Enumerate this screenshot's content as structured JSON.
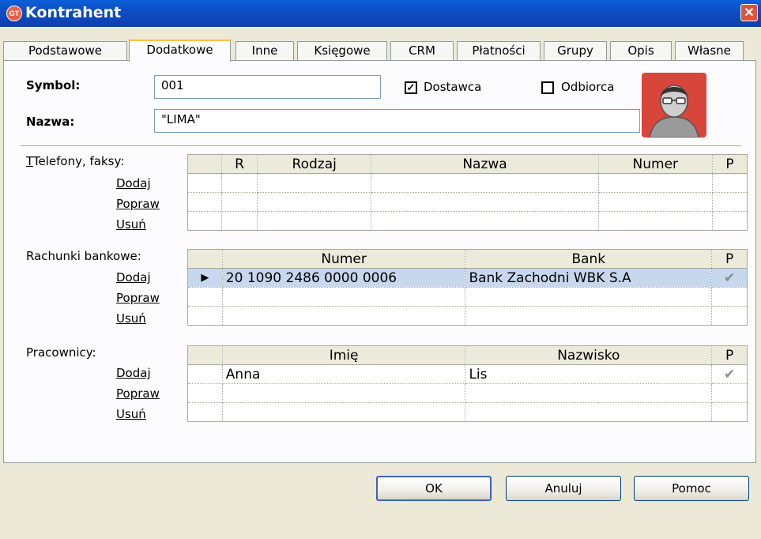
{
  "window": {
    "title": "Kontrahent",
    "close_glyph": "✕",
    "icon_text": "GT"
  },
  "tabs": [
    "Podstawowe",
    "Dodatkowe",
    "Inne",
    "Księgowe",
    "CRM",
    "Płatności",
    "Grupy",
    "Opis",
    "Własne"
  ],
  "active_tab": "Dodatkowe",
  "form": {
    "symbol_label": "Symbol:",
    "symbol_value": "001",
    "nazwa_label": "Nazwa:",
    "nazwa_value": "\"LIMA\"",
    "dostawca_label": "Dostawca",
    "dostawca_checked": true,
    "odbiorca_label": "Odbiorca",
    "odbiorca_checked": false
  },
  "actions": {
    "add": "Dodaj",
    "edit": "Popraw",
    "delete": "Usuń"
  },
  "phones": {
    "label": "Telefony, faksy:",
    "columns": [
      "R",
      "Rodzaj",
      "Nazwa",
      "Numer",
      "P"
    ]
  },
  "accounts": {
    "label": "Rachunki bankowe:",
    "columns": [
      "Numer",
      "Bank",
      "P"
    ],
    "rows": [
      {
        "numer": "20 1090 2486 0000 0006",
        "bank": "Bank Zachodni WBK S.A",
        "p": "✔"
      }
    ]
  },
  "employees": {
    "label": "Pracownicy:",
    "columns": [
      "Imię",
      "Nazwisko",
      "P"
    ],
    "rows": [
      {
        "imie": "Anna",
        "nazwisko": "Lis",
        "p": "✔"
      }
    ]
  },
  "buttons": {
    "ok": "OK",
    "cancel": "Anuluj",
    "help": "Pomoc"
  },
  "colors": {
    "title_bar": "#0f4fc4",
    "selected_row": "#c7d7ee",
    "avatar_bg": "#d8453a"
  }
}
